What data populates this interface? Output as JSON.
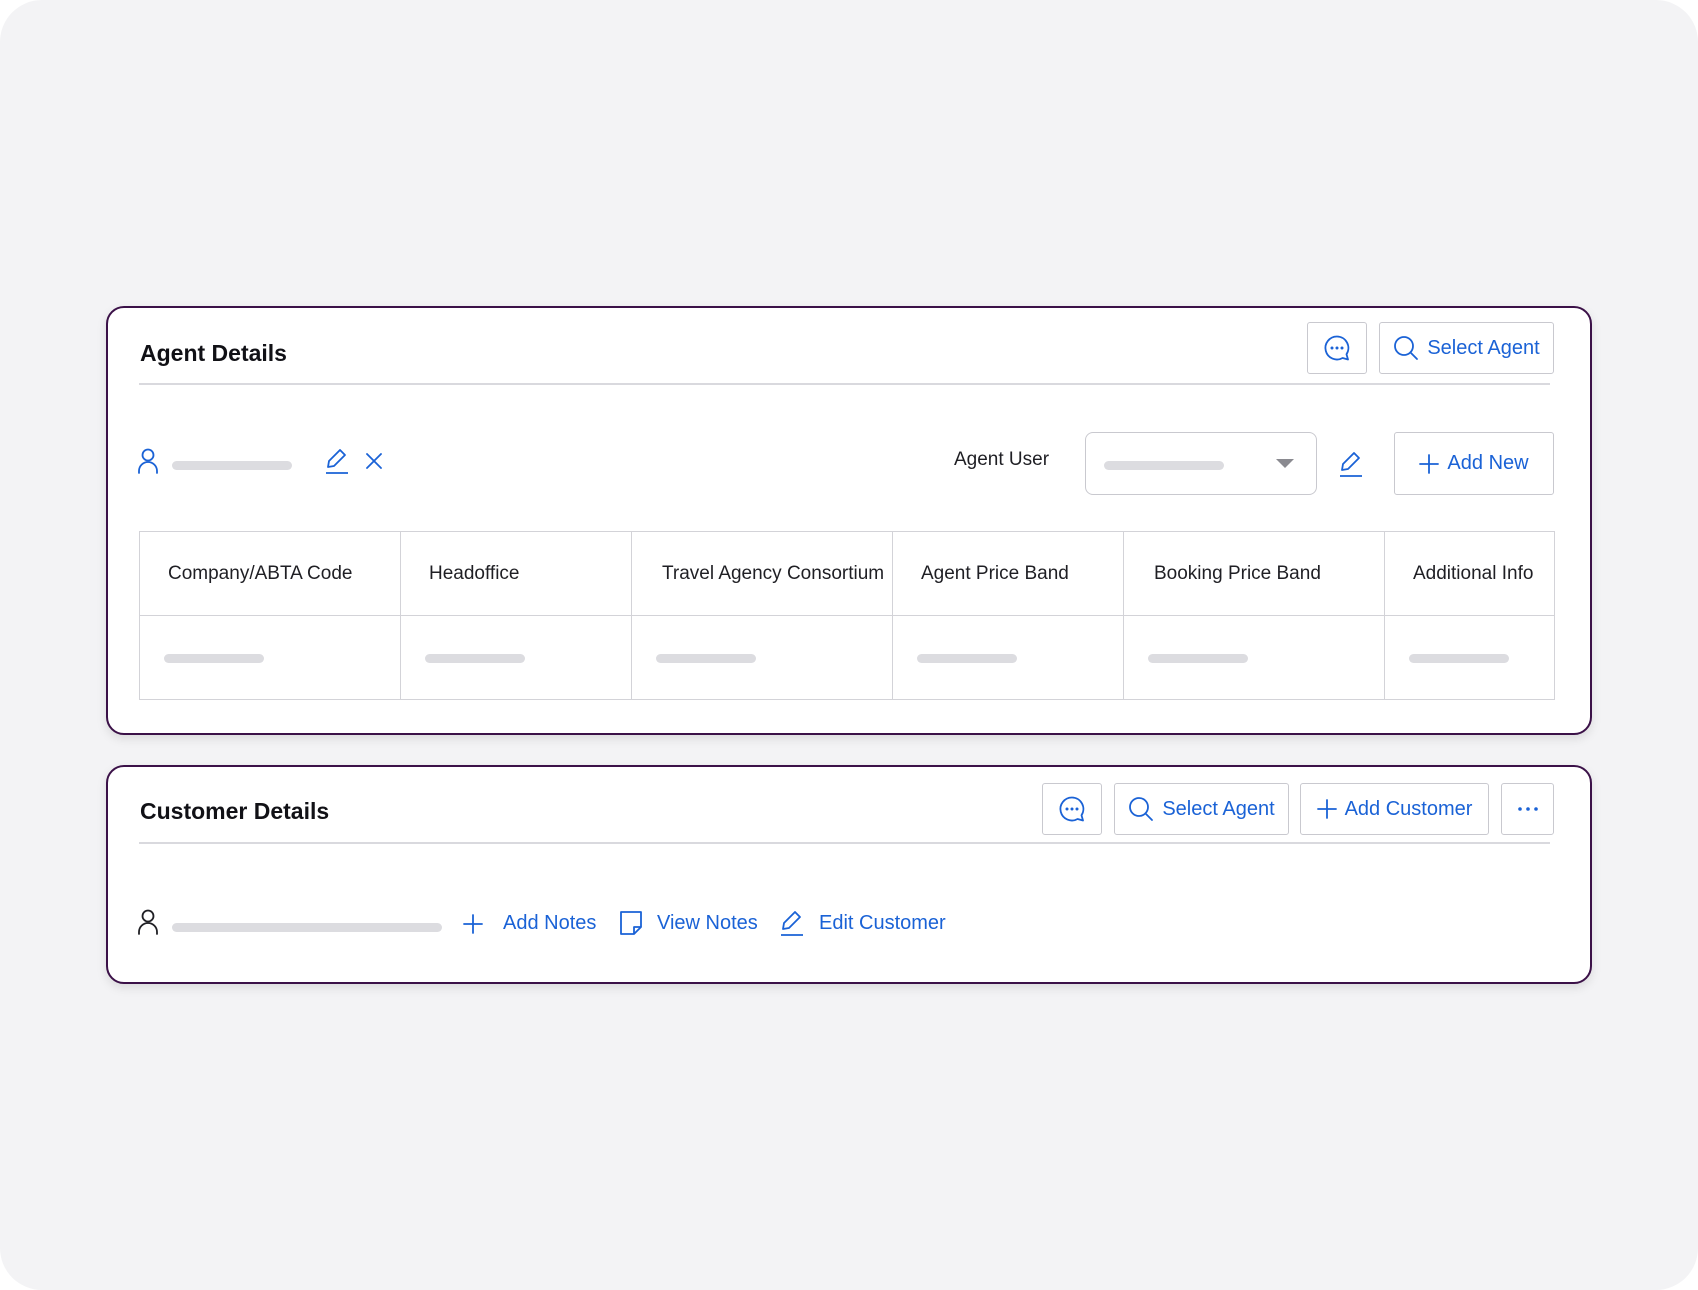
{
  "agent_details": {
    "title": "Agent Details",
    "select_agent_label": "Select Agent",
    "agent_user_label": "Agent User",
    "add_new_label": "Add New",
    "table": {
      "columns": [
        "Company/ABTA Code",
        "Headoffice",
        "Travel Agency Consortium",
        "Agent Price Band",
        "Booking Price Band",
        "Additional Info"
      ]
    }
  },
  "customer_details": {
    "title": "Customer Details",
    "select_agent_label": "Select Agent",
    "add_customer_label": "Add Customer",
    "add_notes_label": "Add Notes",
    "view_notes_label": "View Notes",
    "edit_customer_label": "Edit Customer"
  },
  "colors": {
    "accent": "#1a62d6",
    "card_border": "#3b1148",
    "background": "#f3f3f5"
  },
  "icons": [
    "chat-icon",
    "search-icon",
    "user-icon",
    "edit-icon",
    "close-icon",
    "chevron-down-icon",
    "plus-icon",
    "note-icon",
    "more-icon"
  ]
}
